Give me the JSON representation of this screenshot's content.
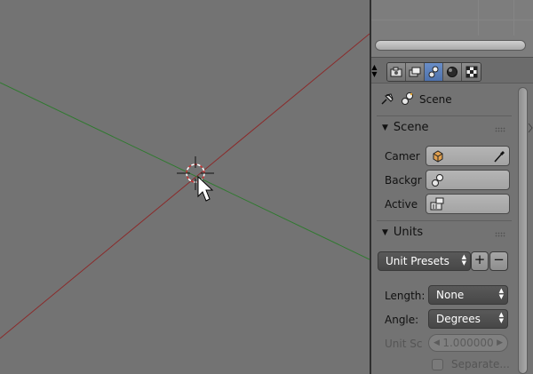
{
  "properties": {
    "context_icons": [
      "render-camera-icon",
      "render-layers-icon",
      "scene-icon",
      "world-icon",
      "texture-icon"
    ],
    "active_context": "scene-icon",
    "breadcrumb": {
      "label": "Scene"
    }
  },
  "scene_panel": {
    "title": "Scene",
    "camera_label": "Camer",
    "background_label": "Backgr",
    "active_label": "Active"
  },
  "units_panel": {
    "title": "Units",
    "presets_label": "Unit Presets",
    "add_label": "+",
    "remove_label": "−",
    "length_label": "Length:",
    "length_value": "None",
    "angle_label": "Angle:",
    "angle_value": "Degrees",
    "unit_scale_label": "Unit Sc",
    "unit_scale_value": "1.000000",
    "separate_label": "Separate..."
  },
  "colors": {
    "viewport_bg": "#737373",
    "x_axis": "#8b2a2a",
    "y_axis": "#2a7a2a",
    "active_tab": "#5a7fbd"
  }
}
